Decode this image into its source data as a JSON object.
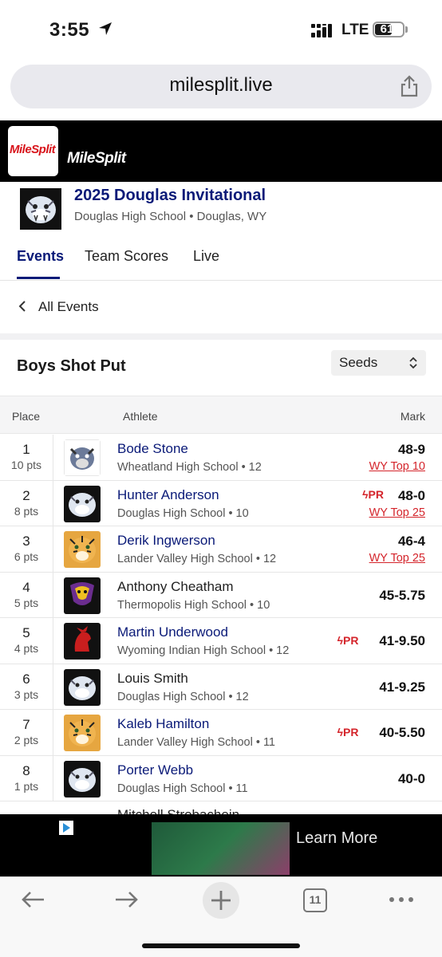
{
  "status": {
    "time": "3:55",
    "network": "LTE",
    "battery": "61",
    "battery_level": 0.61
  },
  "browser": {
    "url": "milesplit.live",
    "tab_count": "11"
  },
  "site": {
    "logo_text": "MileSplit",
    "brand": "MileSplit"
  },
  "meet": {
    "title": "2025 Douglas Invitational",
    "subtitle": "Douglas High School • Douglas, WY",
    "tabs": [
      "Events",
      "Team Scores",
      "Live"
    ]
  },
  "nav": {
    "back_label": "All Events"
  },
  "event": {
    "name": "Boys Shot Put",
    "view_select": "Seeds"
  },
  "table": {
    "headers": {
      "place": "Place",
      "athlete": "Athlete",
      "mark": "Mark"
    },
    "rows": [
      {
        "place": "1",
        "pts": "10 pts",
        "athlete": "Bode Stone",
        "school": "Wheatland High School • 12",
        "mark": "48-9",
        "pr": "",
        "top": "WY Top 10",
        "logo": "bulldog",
        "link": true
      },
      {
        "place": "2",
        "pts": "8 pts",
        "athlete": "Hunter Anderson",
        "school": "Douglas High School • 10",
        "mark": "48-0",
        "pr": "PR",
        "top": "WY Top 25",
        "logo": "bearcat",
        "link": true
      },
      {
        "place": "3",
        "pts": "6 pts",
        "athlete": "Derik Ingwerson",
        "school": "Lander Valley High School • 12",
        "mark": "46-4",
        "pr": "",
        "top": "WY Top 25",
        "logo": "tiger",
        "link": true
      },
      {
        "place": "4",
        "pts": "5 pts",
        "athlete": "Anthony Cheatham",
        "school": "Thermopolis High School • 10",
        "mark": "45-5.75",
        "pr": "",
        "top": "",
        "logo": "bobcat",
        "link": false
      },
      {
        "place": "5",
        "pts": "4 pts",
        "athlete": "Martin Underwood",
        "school": "Wyoming Indian High School • 12",
        "mark": "41-9.50",
        "pr": "PR",
        "top": "",
        "logo": "chief",
        "link": true
      },
      {
        "place": "6",
        "pts": "3 pts",
        "athlete": "Louis Smith",
        "school": "Douglas High School • 12",
        "mark": "41-9.25",
        "pr": "",
        "top": "",
        "logo": "bearcat",
        "link": false
      },
      {
        "place": "7",
        "pts": "2 pts",
        "athlete": "Kaleb Hamilton",
        "school": "Lander Valley High School • 11",
        "mark": "40-5.50",
        "pr": "PR",
        "top": "",
        "logo": "tiger",
        "link": true
      },
      {
        "place": "8",
        "pts": "1 pts",
        "athlete": "Porter Webb",
        "school": "Douglas High School • 11",
        "mark": "40-0",
        "pr": "",
        "top": "",
        "logo": "bearcat",
        "link": true
      }
    ],
    "partial_row": "Mitchell Strobachein"
  },
  "ad": {
    "cta": "Learn More"
  },
  "colors": {
    "brand_navy": "#0a1a78",
    "milesplit_red": "#d8141b",
    "pr_red": "#d4242b"
  }
}
